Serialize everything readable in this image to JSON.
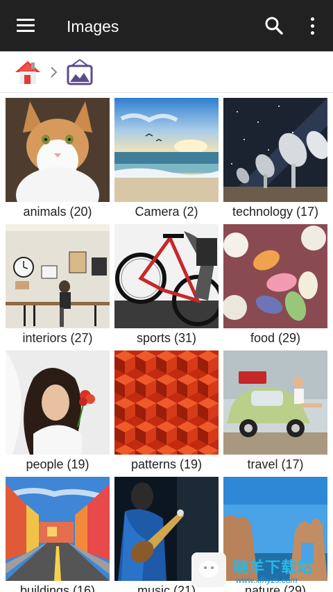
{
  "app": {
    "title": "Images"
  },
  "toolbar": {
    "menu_icon": "hamburger-menu-icon",
    "search_icon": "search-icon",
    "more_icon": "more-vert-icon",
    "background": "#212121"
  },
  "breadcrumb": {
    "home_icon": "home-icon",
    "separator_icon": "chevron-right-icon",
    "current_icon": "image-folder-icon"
  },
  "albums": [
    {
      "label": "animals (20)"
    },
    {
      "label": "Camera (2)"
    },
    {
      "label": "technology (17)"
    },
    {
      "label": "interiors (27)"
    },
    {
      "label": "sports (31)"
    },
    {
      "label": "food (29)"
    },
    {
      "label": "people (19)"
    },
    {
      "label": "patterns (19)"
    },
    {
      "label": "travel (17)"
    },
    {
      "label": "buildings (16)"
    },
    {
      "label": "music (21)"
    },
    {
      "label": "nature (29)"
    }
  ],
  "watermark": {
    "title": "晓羊下载站",
    "url": "www.xfhyzs.com"
  }
}
